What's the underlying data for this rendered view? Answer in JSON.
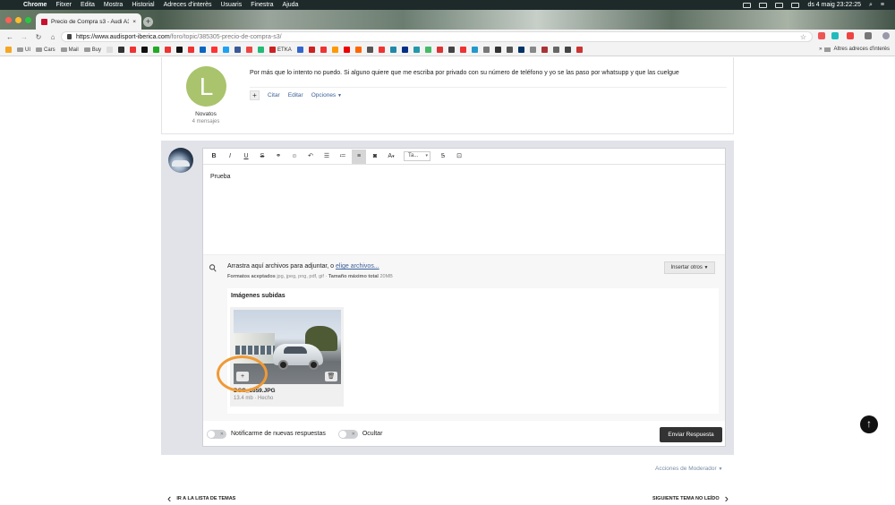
{
  "menubar": {
    "app": "Chrome",
    "items": [
      "Fitxer",
      "Edita",
      "Mostra",
      "Historial",
      "Adreces d'interès",
      "Usuaris",
      "Finestra",
      "Ajuda"
    ],
    "datetime": "ds 4 maig  23:22:25"
  },
  "tab": {
    "title": "Precio de Compra s3 - Audi A3"
  },
  "address": {
    "host": "https://www.audisport-iberica.com",
    "path": "/foro/topic/385305-precio-de-compra-s3/"
  },
  "bookmarks": {
    "items": [
      "UI",
      "Cars",
      "Mail",
      "Buy"
    ],
    "etka": "ETKA",
    "other": "Altres adreces d'interès"
  },
  "post": {
    "avatar_letter": "L",
    "group": "Novatos",
    "messages": "4 mensajes",
    "text": "Por más que lo intento no puedo. Si alguno quiere que me escriba por privado con su número de teléfono y yo se las paso por whatsupp y que las cuelgue",
    "actions": {
      "quote": "Citar",
      "edit": "Editar",
      "options": "Opciones"
    }
  },
  "editor": {
    "font_select": "Ta...",
    "content": "Prueba",
    "attach": {
      "drop_text": "Arrastra aquí archivos para adjuntar, o ",
      "choose_link": "elige archivos...",
      "formats_label": "Formatos aceptados",
      "formats": "jpg, jpeg, png, pdf, gif",
      "max_label": "Tamaño máximo total",
      "max_value": "20MB",
      "insert_other": "Insertar otros"
    },
    "uploaded": {
      "title": "Imágenes subidas",
      "file": {
        "name": "DSC_1659.JPG",
        "meta": "13.4 mb · Hecho"
      }
    }
  },
  "reply_footer": {
    "notify": "Notificarme de nuevas respuestas",
    "hidden": "Ocultar",
    "send": "Enviar Respuesta"
  },
  "mod_actions": "Acciones de Moderador",
  "pagenav": {
    "back": "IR A LA LISTA DE TEMAS",
    "next": "SIGUIENTE TEMA NO LEÍDO"
  },
  "colors": {
    "accent_link": "#3a5f9a",
    "avatar_green": "#a9c46c",
    "highlight": "#ef9a35",
    "send_button": "#333333"
  }
}
